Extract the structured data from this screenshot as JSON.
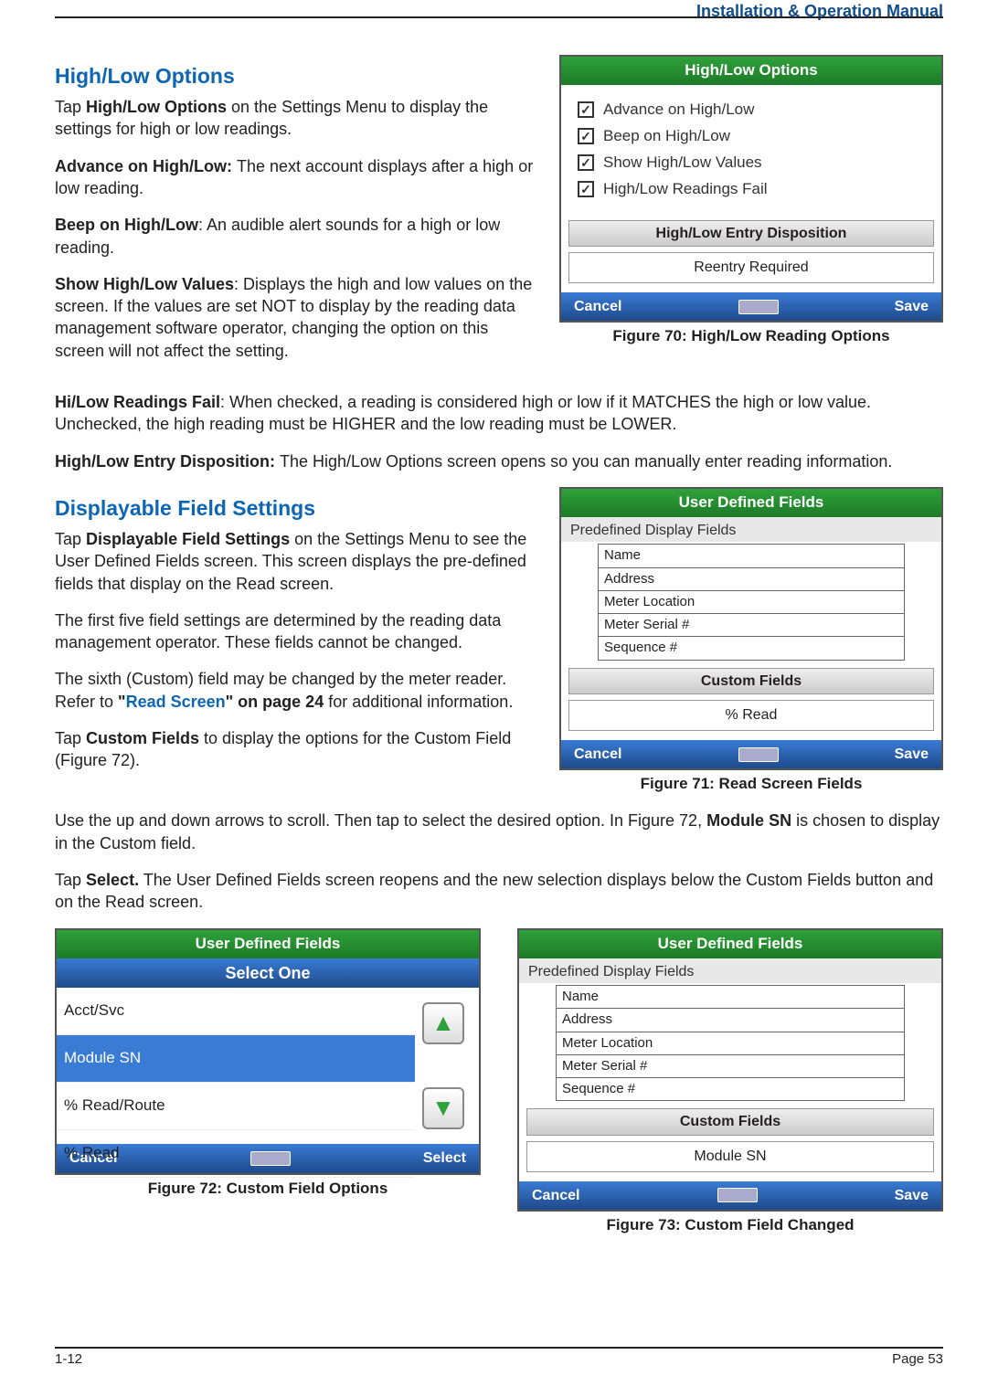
{
  "header": {
    "doc_title": "Installation & Operation Manual"
  },
  "section1": {
    "heading": "High/Low Options",
    "p1a": "Tap ",
    "p1b": "High/Low Options",
    "p1c": " on the Settings Menu to display the settings for high or low readings.",
    "p2a": "Advance on High/Low: ",
    "p2b": "The next account displays after a high or low reading.",
    "p3a": "Beep on High/Low",
    "p3b": ": An audible alert sounds for a high or low reading.",
    "p4a": "Show High/Low Values",
    "p4b": ": Displays the high and low values on the screen. If the values are set NOT to display by the reading data management software operator, changing the option on this screen will not affect the setting.",
    "p5a": "Hi/Low Readings Fail",
    "p5b": ": When checked, a reading is considered high or low if it MATCHES the high or low value. Unchecked, the high reading must be HIGHER and the low reading must be LOWER.",
    "p6a": "High/Low Entry Disposition: ",
    "p6b": "The High/Low Options screen opens so you can manually enter reading information."
  },
  "fig70": {
    "title": "High/Low Options",
    "items": [
      "Advance on High/Low",
      "Beep on High/Low",
      "Show High/Low Values",
      "High/Low Readings Fail"
    ],
    "subheader": "High/Low Entry Disposition",
    "option": "Reentry Required",
    "cancel": "Cancel",
    "save": "Save",
    "caption": "Figure 70:  High/Low Reading Options"
  },
  "section2": {
    "heading": "Displayable Field Settings",
    "p1a": "Tap ",
    "p1b": "Displayable Field Settings",
    "p1c": " on the Settings Menu to see the User Defined Fields screen. This screen displays the pre-defined fields that display on the Read screen.",
    "p2": "The first five field settings are determined by the reading data management operator. These fields cannot be changed.",
    "p3a": "The sixth (Custom) field may be changed by the meter reader. Refer to ",
    "p3b": "\"",
    "p3link": "Read Screen",
    "p3c": "\" on page 24",
    "p3d": " for additional information.",
    "p4a": "Tap ",
    "p4b": "Custom Fields",
    "p4c": " to display the options for the Custom Field (Figure 72).",
    "p5a": "Use the up and down arrows to scroll. Then tap to select the desired option. In Figure 72, ",
    "p5b": "Module SN",
    "p5c": " is chosen to display in the Custom field.",
    "p6a": "Tap ",
    "p6b": "Select.",
    "p6c": " The User Defined Fields screen reopens and the new selection displays below the Custom Fields button and on the Read screen."
  },
  "fig71": {
    "title": "User Defined Fields",
    "predef_label": "Predefined Display Fields",
    "fields": [
      "Name",
      "Address",
      "Meter Location",
      "Meter Serial #",
      "Sequence #"
    ],
    "custom_header": "Custom Fields",
    "custom_value": "% Read",
    "cancel": "Cancel",
    "save": "Save",
    "caption": "Figure 71:  Read Screen Fields"
  },
  "fig72": {
    "title": "User Defined Fields",
    "select_one": "Select One",
    "options": [
      "Acct/Svc",
      "Module SN",
      "% Read/Route",
      "% Read"
    ],
    "cancel": "Cancel",
    "select": "Select",
    "caption": "Figure 72:  Custom Field Options"
  },
  "fig73": {
    "title": "User Defined Fields",
    "predef_label": "Predefined Display Fields",
    "fields": [
      "Name",
      "Address",
      "Meter Location",
      "Meter Serial #",
      "Sequence #"
    ],
    "custom_header": "Custom Fields",
    "custom_value": "Module SN",
    "cancel": "Cancel",
    "save": "Save",
    "caption": "Figure 73:  Custom Field Changed"
  },
  "footer": {
    "left": "1-12",
    "right": "Page 53"
  }
}
